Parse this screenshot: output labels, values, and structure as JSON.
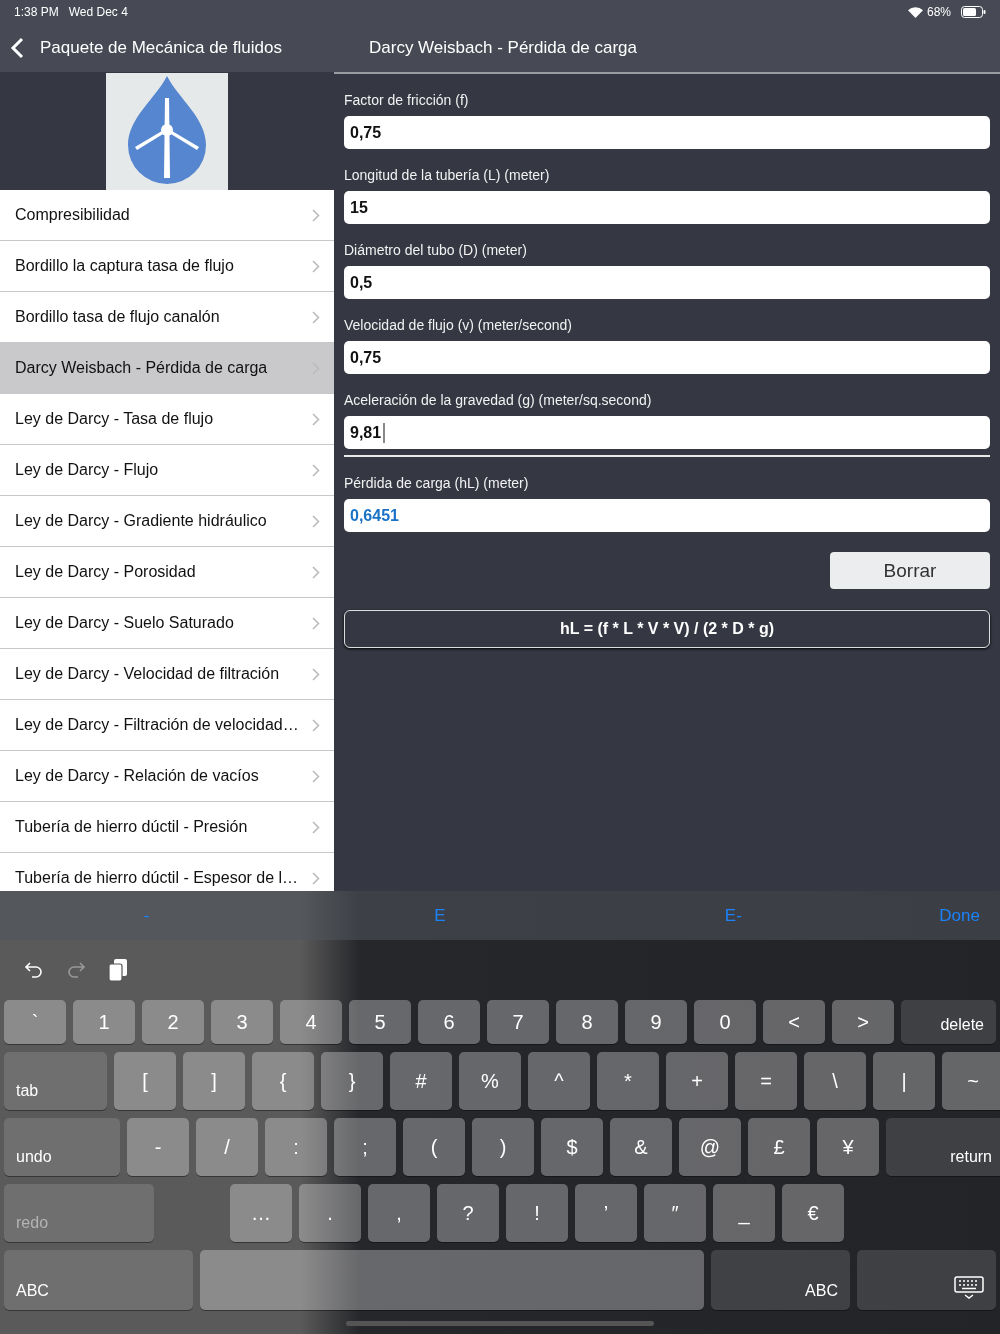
{
  "status_bar": {
    "time": "1:38 PM",
    "date": "Wed Dec 4",
    "battery": "68%"
  },
  "nav": {
    "back_label": "Paquete de Mecánica de fluidos",
    "title": "Darcy Weisbach - Pérdida de carga"
  },
  "sidebar": {
    "items": [
      {
        "label": "Compresibilidad",
        "selected": false
      },
      {
        "label": "Bordillo la captura tasa de flujo",
        "selected": false
      },
      {
        "label": "Bordillo tasa de flujo canalón",
        "selected": false
      },
      {
        "label": "Darcy Weisbach - Pérdida de carga",
        "selected": true
      },
      {
        "label": "Ley de Darcy - Tasa de flujo",
        "selected": false
      },
      {
        "label": "Ley de Darcy - Flujo",
        "selected": false
      },
      {
        "label": "Ley de Darcy - Gradiente hidráulico",
        "selected": false
      },
      {
        "label": "Ley de Darcy - Porosidad",
        "selected": false
      },
      {
        "label": "Ley de Darcy - Suelo Saturado",
        "selected": false
      },
      {
        "label": "Ley de Darcy - Velocidad de filtración",
        "selected": false
      },
      {
        "label": "Ley de Darcy - Filtración de velocidad…",
        "selected": false
      },
      {
        "label": "Ley de Darcy - Relación de vacíos",
        "selected": false
      },
      {
        "label": "Tubería de hierro dúctil - Presión",
        "selected": false
      },
      {
        "label": "Tubería de hierro dúctil - Espesor de l…",
        "selected": false
      }
    ]
  },
  "form": {
    "fields": [
      {
        "label": "Factor de fricción (f)",
        "value": "0,75",
        "kind": "input",
        "focused": false
      },
      {
        "label": "Longitud de la tubería (L) (meter)",
        "value": "15",
        "kind": "input",
        "focused": false
      },
      {
        "label": "Diámetro del tubo (D) (meter)",
        "value": "0,5",
        "kind": "input",
        "focused": false
      },
      {
        "label": "Velocidad de flujo (v) (meter/second)",
        "value": "0,75",
        "kind": "input",
        "focused": false
      },
      {
        "label": "Aceleración de la gravedad (g) (meter/sq.second)",
        "value": "9,81",
        "kind": "input",
        "focused": true
      },
      {
        "label": "Pérdida de carga (hL) (meter)",
        "value": "0,6451",
        "kind": "result",
        "focused": false
      }
    ],
    "clear_button": "Borrar",
    "formula": "hL = (f * L * V * V) / (2 * D * g)"
  },
  "keyboard": {
    "suggestions": [
      "-",
      "E",
      "E-"
    ],
    "done": "Done",
    "rows": [
      {
        "keys": [
          {
            "label": "`",
            "kind": "char"
          },
          {
            "label": "1",
            "kind": "char"
          },
          {
            "label": "2",
            "kind": "char"
          },
          {
            "label": "3",
            "kind": "char"
          },
          {
            "label": "4",
            "kind": "char"
          },
          {
            "label": "5",
            "kind": "char"
          },
          {
            "label": "6",
            "kind": "char"
          },
          {
            "label": "7",
            "kind": "char"
          },
          {
            "label": "8",
            "kind": "char"
          },
          {
            "label": "9",
            "kind": "char"
          },
          {
            "label": "0",
            "kind": "char"
          },
          {
            "label": "<",
            "kind": "char"
          },
          {
            "label": ">",
            "kind": "char"
          },
          {
            "label": "delete",
            "kind": "function",
            "disabled": false
          }
        ]
      },
      {
        "keys": [
          {
            "label": "tab",
            "kind": "function",
            "disabled": false
          },
          {
            "label": "[",
            "kind": "char"
          },
          {
            "label": "]",
            "kind": "char"
          },
          {
            "label": "{",
            "kind": "char"
          },
          {
            "label": "}",
            "kind": "char"
          },
          {
            "label": "#",
            "kind": "char"
          },
          {
            "label": "%",
            "kind": "char"
          },
          {
            "label": "^",
            "kind": "char"
          },
          {
            "label": "*",
            "kind": "char"
          },
          {
            "label": "+",
            "kind": "char"
          },
          {
            "label": "=",
            "kind": "char"
          },
          {
            "label": "\\",
            "kind": "char"
          },
          {
            "label": "|",
            "kind": "char"
          },
          {
            "label": "~",
            "kind": "char"
          }
        ]
      },
      {
        "keys": [
          {
            "label": "undo",
            "kind": "function",
            "disabled": false
          },
          {
            "label": "-",
            "kind": "char"
          },
          {
            "label": "/",
            "kind": "char"
          },
          {
            "label": ":",
            "kind": "char"
          },
          {
            "label": ";",
            "kind": "char"
          },
          {
            "label": "(",
            "kind": "char"
          },
          {
            "label": ")",
            "kind": "char"
          },
          {
            "label": "$",
            "kind": "char"
          },
          {
            "label": "&",
            "kind": "char"
          },
          {
            "label": "@",
            "kind": "char"
          },
          {
            "label": "£",
            "kind": "char"
          },
          {
            "label": "¥",
            "kind": "char"
          },
          {
            "label": "return",
            "kind": "function",
            "disabled": false
          }
        ]
      },
      {
        "keys": [
          {
            "label": "redo",
            "kind": "function",
            "disabled": true
          },
          {
            "label": "…",
            "kind": "char"
          },
          {
            "label": ".",
            "kind": "char"
          },
          {
            "label": ",",
            "kind": "char"
          },
          {
            "label": "?",
            "kind": "char"
          },
          {
            "label": "!",
            "kind": "char"
          },
          {
            "label": "’",
            "kind": "char"
          },
          {
            "label": "″",
            "kind": "char"
          },
          {
            "label": "_",
            "kind": "char"
          },
          {
            "label": "€",
            "kind": "char"
          }
        ]
      },
      {
        "keys": [
          {
            "label": "ABC",
            "kind": "function",
            "disabled": false
          },
          {
            "kind": "space"
          },
          {
            "label": "ABC",
            "kind": "function",
            "disabled": false
          },
          {
            "kind": "hide"
          }
        ]
      }
    ]
  }
}
